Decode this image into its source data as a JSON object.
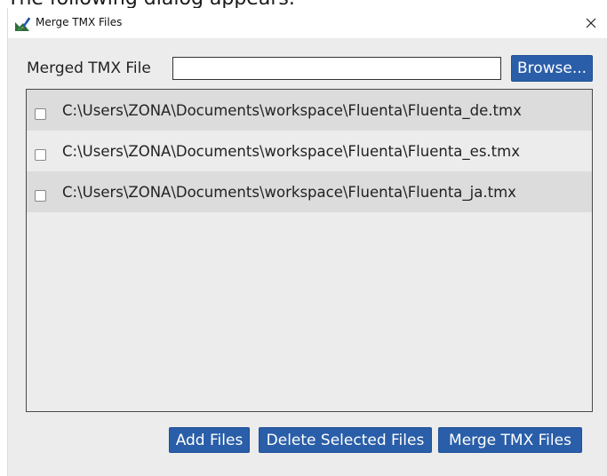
{
  "page_caption": "The following dialog appears.",
  "window": {
    "title": "Merge TMX Files",
    "close_glyph": "✕"
  },
  "form": {
    "merged_label": "Merged TMX File",
    "merged_value": "",
    "browse_label": "Browse..."
  },
  "files": [
    "C:\\Users\\ZONA\\Documents\\workspace\\Fluenta\\Fluenta_de.tmx",
    "C:\\Users\\ZONA\\Documents\\workspace\\Fluenta\\Fluenta_es.tmx",
    "C:\\Users\\ZONA\\Documents\\workspace\\Fluenta\\Fluenta_ja.tmx"
  ],
  "actions": {
    "add_label": "Add Files",
    "delete_label": "Delete Selected Files",
    "merge_label": "Merge TMX Files"
  },
  "colors": {
    "button_bg": "#2a5ea8",
    "dialog_bg": "#ececec",
    "row_alt_bg": "#dcdcdc"
  },
  "icons": {
    "app": "merge-tmx-app-icon",
    "close": "close-icon"
  }
}
